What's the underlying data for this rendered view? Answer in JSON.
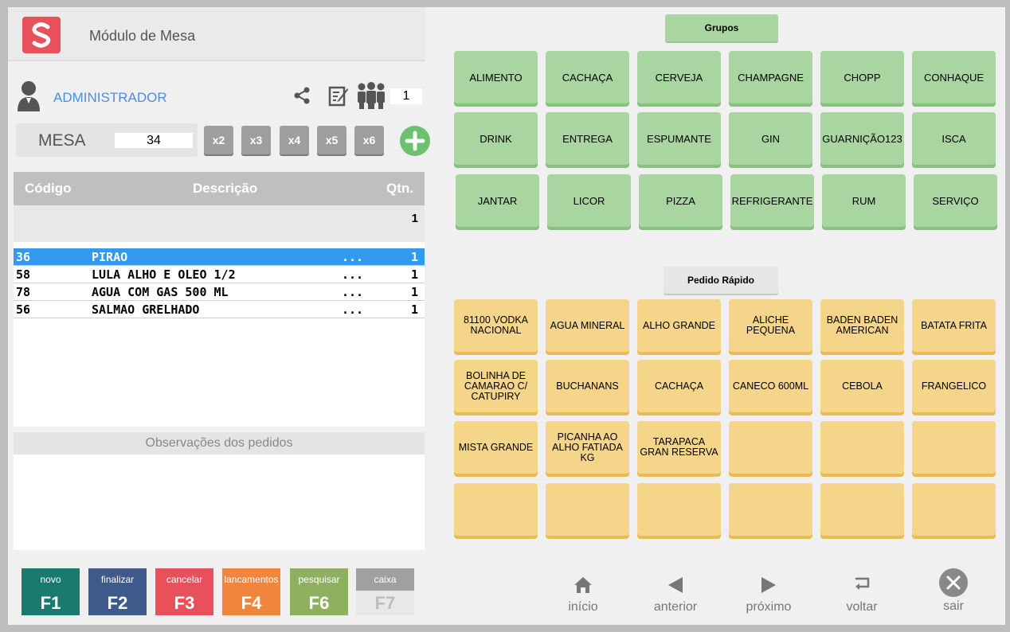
{
  "header": {
    "title": "Módulo de Mesa"
  },
  "user": {
    "name": "ADMINISTRADOR",
    "people_count": "1"
  },
  "mesa": {
    "label": "MESA",
    "value": "34",
    "multipliers": [
      "x2",
      "x3",
      "x4",
      "x5",
      "x6"
    ]
  },
  "items": {
    "columns": {
      "code": "Código",
      "description": "Descrição",
      "qty": "Qtn."
    },
    "subtotal_qty": "1",
    "rows": [
      {
        "code": "36",
        "description": "PIRAO",
        "more": "...",
        "qty": "1",
        "selected": true
      },
      {
        "code": "58",
        "description": "LULA ALHO E OLEO 1/2",
        "more": "...",
        "qty": "1",
        "selected": false
      },
      {
        "code": "78",
        "description": "AGUA COM GAS 500 ML",
        "more": "...",
        "qty": "1",
        "selected": false
      },
      {
        "code": "56",
        "description": "SALMAO GRELHADO",
        "more": "...",
        "qty": "1",
        "selected": false
      }
    ]
  },
  "observations": {
    "title": "Observações dos pedidos"
  },
  "function_keys": [
    {
      "label": "novo",
      "key": "F1",
      "color": "#1a7a6e"
    },
    {
      "label": "finalizar",
      "key": "F2",
      "color": "#3d5a8a"
    },
    {
      "label": "cancelar",
      "key": "F3",
      "color": "#e8505b"
    },
    {
      "label": "lancamentos",
      "key": "F4",
      "color": "#f0853e"
    },
    {
      "label": "pesquisar",
      "key": "F6",
      "color": "#8fb060"
    },
    {
      "label": "caixa",
      "key": "F7",
      "color": "#a0a0a0"
    }
  ],
  "groups": {
    "title": "Grupos",
    "items": [
      "ALIMENTO",
      "CACHAÇA",
      "CERVEJA",
      "CHAMPAGNE",
      "CHOPP",
      "CONHAQUE",
      "DRINK",
      "ENTREGA",
      "ESPUMANTE",
      "GIN",
      "GUARNIÇÃO123",
      "ISCA",
      "JANTAR",
      "LICOR",
      "PIZZA",
      "REFRIGERANTE",
      "RUM",
      "SERVIÇO"
    ]
  },
  "quick_order": {
    "title": "Pedido Rápido",
    "items": [
      "81100 VODKA NACIONAL",
      "AGUA MINERAL",
      "ALHO GRANDE",
      "ALICHE PEQUENA",
      "BADEN BADEN AMERICAN",
      "BATATA FRITA",
      "BOLINHA DE CAMARAO C/ CATUPIRY",
      "BUCHANANS",
      "CACHAÇA",
      "CANECO 600ML",
      "CEBOLA",
      "FRANGELICO",
      "MISTA GRANDE",
      "PICANHA AO ALHO FATIADA KG",
      "TARAPACA GRAN RESERVA",
      "",
      "",
      "",
      "",
      "",
      "",
      "",
      "",
      ""
    ]
  },
  "navigation": [
    {
      "label": "início",
      "icon": "home-icon"
    },
    {
      "label": "anterior",
      "icon": "arrow-left-icon"
    },
    {
      "label": "próximo",
      "icon": "arrow-right-icon"
    },
    {
      "label": "voltar",
      "icon": "return-icon"
    },
    {
      "label": "sair",
      "icon": "close-icon"
    }
  ]
}
